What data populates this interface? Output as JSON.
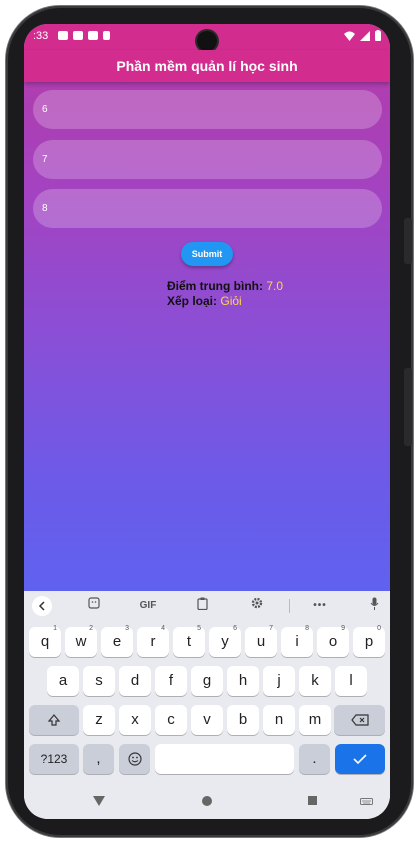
{
  "status": {
    "time": ":33"
  },
  "app": {
    "title": "Phần mềm quản lí học sinh",
    "fields": [
      {
        "value": "6"
      },
      {
        "value": "7"
      },
      {
        "value": "8"
      }
    ],
    "submit_label": "Submit",
    "average_label": "Điểm trung bình:",
    "average_value": "7.0",
    "rank_label": "Xếp loại:",
    "rank_value": "Giỏi"
  },
  "keyboard": {
    "toolbar": {
      "gif_label": "GIF"
    },
    "row1": [
      {
        "k": "q",
        "h": "1"
      },
      {
        "k": "w",
        "h": "2"
      },
      {
        "k": "e",
        "h": "3"
      },
      {
        "k": "r",
        "h": "4"
      },
      {
        "k": "t",
        "h": "5"
      },
      {
        "k": "y",
        "h": "6"
      },
      {
        "k": "u",
        "h": "7"
      },
      {
        "k": "i",
        "h": "8"
      },
      {
        "k": "o",
        "h": "9"
      },
      {
        "k": "p",
        "h": "0"
      }
    ],
    "row2": [
      "a",
      "s",
      "d",
      "f",
      "g",
      "h",
      "j",
      "k",
      "l"
    ],
    "row3": [
      "z",
      "x",
      "c",
      "v",
      "b",
      "n",
      "m"
    ],
    "symbols_label": "?123",
    "comma_label": ",",
    "period_label": "."
  },
  "colors": {
    "appbar": "#d22c8f",
    "submit": "#2196f3",
    "result_value": "#ffd54f",
    "enter_key": "#1a73e8"
  }
}
